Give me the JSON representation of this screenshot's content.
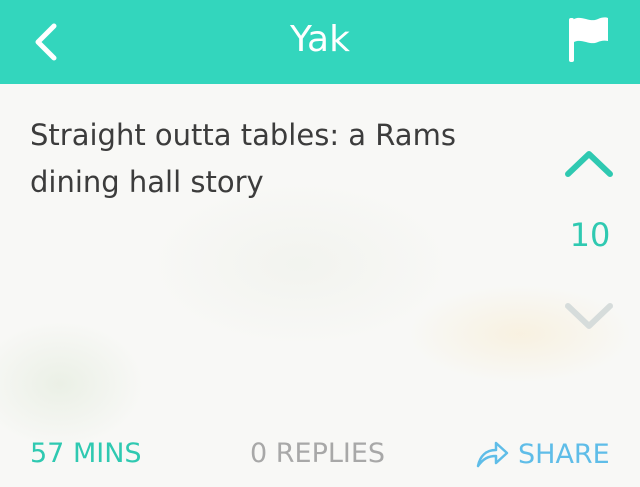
{
  "header": {
    "title": "Yak",
    "back_icon": "chevron-left-icon",
    "flag_icon": "flag-icon",
    "background_color": "#33d6bd"
  },
  "post": {
    "text": "Straight outta tables: a Rams dining hall story",
    "score": "10",
    "time": "57 MINS",
    "replies": "0 REPLIES",
    "share_label": "SHARE",
    "upvote_icon": "chevron-up-icon",
    "downvote_icon": "chevron-down-icon",
    "share_icon": "share-arrow-icon"
  },
  "colors": {
    "accent": "#2fc9b1",
    "vote_inactive": "#d6dcdb",
    "share": "#5fbde8",
    "muted": "#a8a8a8"
  }
}
